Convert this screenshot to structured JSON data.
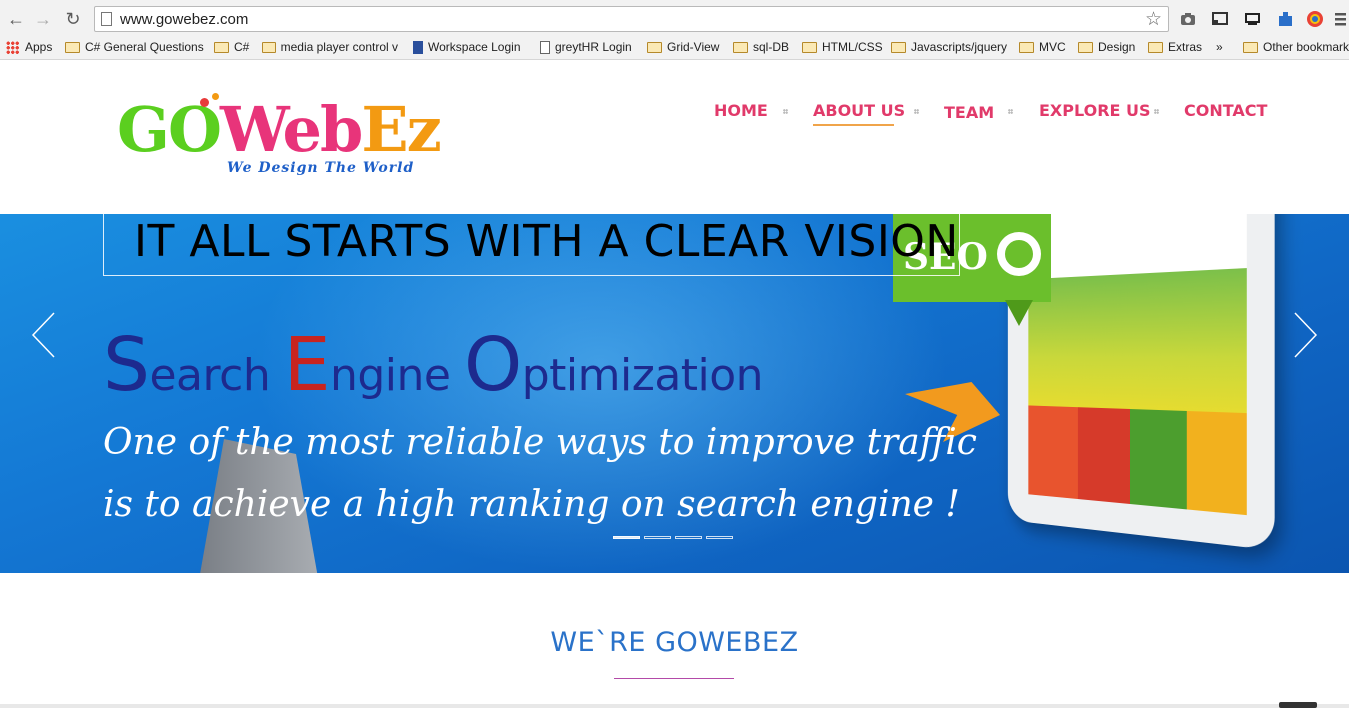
{
  "browser": {
    "url": "www.gowebez.com",
    "bookmarks": [
      {
        "label": "Apps",
        "kind": "apps"
      },
      {
        "label": "C# General Questions",
        "kind": "folder"
      },
      {
        "label": "C#",
        "kind": "folder"
      },
      {
        "label": "media player control v",
        "kind": "folder"
      },
      {
        "label": "Workspace Login",
        "kind": "link"
      },
      {
        "label": "greytHR Login",
        "kind": "page"
      },
      {
        "label": "Grid-View",
        "kind": "folder"
      },
      {
        "label": "sql-DB",
        "kind": "folder"
      },
      {
        "label": "HTML/CSS",
        "kind": "folder"
      },
      {
        "label": "Javascripts/jquery",
        "kind": "folder"
      },
      {
        "label": "MVC",
        "kind": "folder"
      },
      {
        "label": "Design",
        "kind": "folder"
      },
      {
        "label": "Extras",
        "kind": "folder"
      },
      {
        "label": "»",
        "kind": "more"
      },
      {
        "label": "Other bookmarks",
        "kind": "folder"
      }
    ]
  },
  "site": {
    "logo": {
      "text": "GOWebEz",
      "tagline": "We Design The World"
    },
    "nav": [
      {
        "label": "HOME"
      },
      {
        "label": "ABOUT US",
        "active": true
      },
      {
        "label": "TEAM"
      },
      {
        "label": "EXPLORE US"
      },
      {
        "label": "CONTACT"
      }
    ],
    "hero": {
      "headline": "IT ALL STARTS WITH A CLEAR VISION",
      "seo_title": {
        "w1_cap": "S",
        "w1_rest": "earch",
        "w2_cap": "E",
        "w2_rest": "ngine",
        "w3_cap": "O",
        "w3_rest": "ptimization"
      },
      "line1": "One of the most reliable ways to improve traffic",
      "line2": "is to achieve a high ranking on search engine !",
      "badge": "SEO",
      "slide_count": 4,
      "active_slide": 1
    },
    "section": {
      "title": "WE`RE GOWEBEZ"
    }
  },
  "colors": {
    "nav": "#e13a6a",
    "hero_blue": "#1478d4",
    "seo_green": "#6bbf2c",
    "section_title": "#2a72c9"
  }
}
